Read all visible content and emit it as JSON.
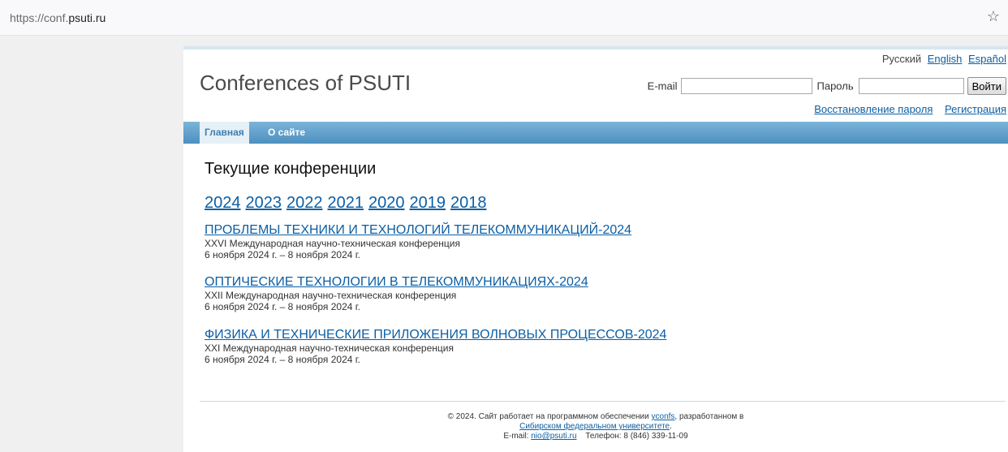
{
  "browser": {
    "url_prefix": "https://conf.",
    "url_domain": "psuti.ru"
  },
  "header": {
    "languages": [
      "Русский",
      "English",
      "Español"
    ],
    "site_title": "Conferences of PSUTI",
    "email_label": "E-mail",
    "password_label": "Пароль",
    "login_button": "Войти",
    "restore_link": "Восстановление пароля",
    "register_link": "Регистрация"
  },
  "nav": {
    "tabs": [
      "Главная",
      "О сайте"
    ]
  },
  "main": {
    "heading": "Текущие конференции",
    "years": [
      "2024",
      "2023",
      "2022",
      "2021",
      "2020",
      "2019",
      "2018"
    ],
    "conferences": [
      {
        "title": "ПРОБЛЕМЫ ТЕХНИКИ И ТЕХНОЛОГИЙ ТЕЛЕКОММУНИКАЦИЙ-2024",
        "subtitle": "XXVI Международная научно-техническая конференция",
        "dates": "6 ноября 2024 г. – 8 ноября 2024 г."
      },
      {
        "title": "ОПТИЧЕСКИЕ ТЕХНОЛОГИИ В ТЕЛЕКОММУНИКАЦИЯХ-2024",
        "subtitle": "XXII Международная научно-техническая конференция",
        "dates": "6 ноября 2024 г. – 8 ноября 2024 г."
      },
      {
        "title": "ФИЗИКА И ТЕХНИЧЕСКИЕ ПРИЛОЖЕНИЯ ВОЛНОВЫХ ПРОЦЕССОВ-2024",
        "subtitle": "XXI Международная научно-техническая конференция",
        "dates": "6 ноября 2024 г. – 8 ноября 2024 г."
      }
    ]
  },
  "footer": {
    "line1_text": "© 2024. Сайт работает на программном обеспечении",
    "line1_link": "yconfs",
    "line1_tail": ", разработанном в",
    "line2_link": "Сибирском федеральном университете",
    "line2_tail": ".",
    "email_label": "E-mail:",
    "email_link": "nio@psuti.ru",
    "phone": "Телефон: 8 (846) 339-11-09"
  }
}
